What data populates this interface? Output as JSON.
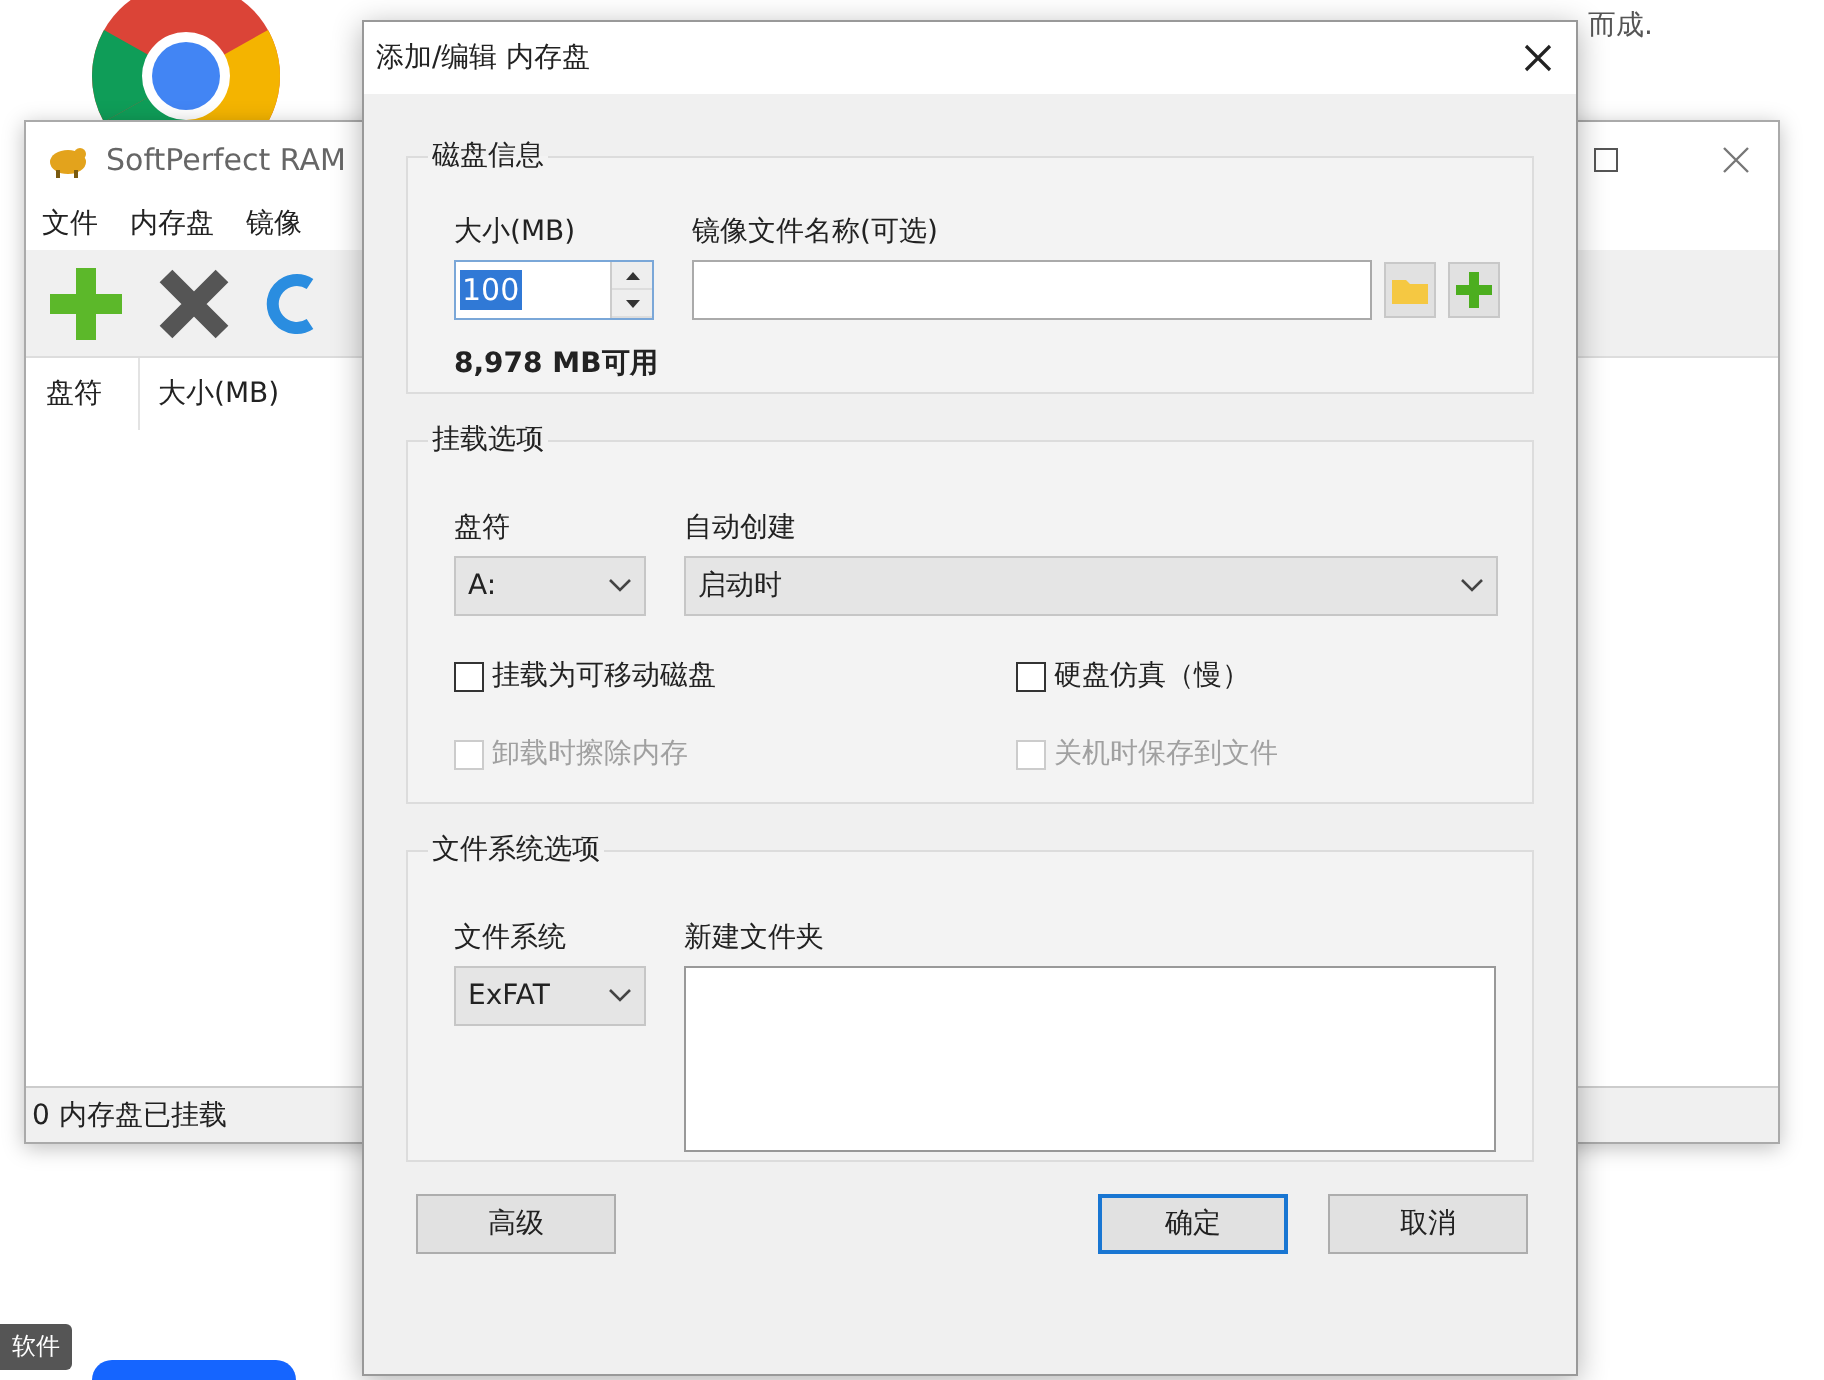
{
  "background": {
    "text": "而成.",
    "tag": "软件"
  },
  "main_window": {
    "title": "SoftPerfect RAM",
    "menu": [
      "文件",
      "内存盘",
      "镜像"
    ],
    "columns": [
      "盘符",
      "大小(MB)"
    ],
    "status_bar": "0 内存盘已挂载"
  },
  "dialog": {
    "title": "添加/编辑 内存盘",
    "disk_info": {
      "title": "磁盘信息",
      "size_label": "大小(MB)",
      "size_value": "100",
      "size_selected": true,
      "image_label": "镜像文件名称(可选)",
      "available": "8,978 MB可用"
    },
    "mount_options": {
      "title": "挂载选项",
      "drive_label": "盘符",
      "drive_value": "A:",
      "autocreate_label": "自动创建",
      "autocreate_value": "启动时",
      "checkboxes": [
        {
          "label": "挂载为可移动磁盘",
          "checked": false,
          "disabled": false
        },
        {
          "label": "硬盘仿真（慢）",
          "checked": false,
          "disabled": false
        },
        {
          "label": "卸载时擦除内存",
          "checked": false,
          "disabled": true
        },
        {
          "label": "关机时保存到文件",
          "checked": false,
          "disabled": true
        }
      ]
    },
    "fs_options": {
      "title": "文件系统选项",
      "fs_label": "文件系统",
      "fs_value": "ExFAT",
      "folder_label": "新建文件夹"
    },
    "buttons": [
      {
        "label": "高级",
        "default": false
      },
      {
        "label": "确定",
        "default": true
      },
      {
        "label": "取消",
        "default": false
      }
    ]
  }
}
